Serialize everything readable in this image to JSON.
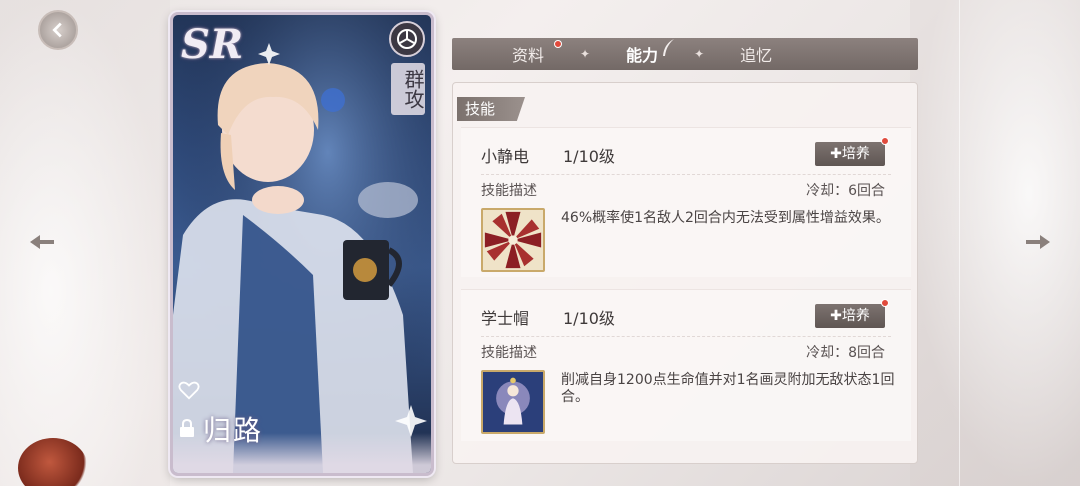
{
  "card": {
    "rarity": "SR",
    "target_type": "群攻",
    "character_name": "归路"
  },
  "tabs": [
    {
      "label": "资料",
      "active": false,
      "badge": true
    },
    {
      "label": "能力",
      "active": true,
      "badge": false
    },
    {
      "label": "追忆",
      "active": false,
      "badge": false
    }
  ],
  "panel": {
    "title": "技能"
  },
  "skills": [
    {
      "name": "小静电",
      "level": "1/10级",
      "train_label": "培养",
      "desc_label": "技能描述",
      "cooldown": "冷却：6回合",
      "description": "46%概率使1名敌人2回合内无法受到属性增益效果。",
      "icon": "swirl-icon"
    },
    {
      "name": "学士帽",
      "level": "1/10级",
      "train_label": "培养",
      "desc_label": "技能描述",
      "cooldown": "冷却：8回合",
      "description": "削减自身1200点生命值并对1名画灵附加无敌状态1回合。",
      "icon": "maiden-icon"
    }
  ],
  "colors": {
    "accent": "#7d7370",
    "badge_red": "#e04a3c",
    "icon_border": "#c9a96a"
  }
}
